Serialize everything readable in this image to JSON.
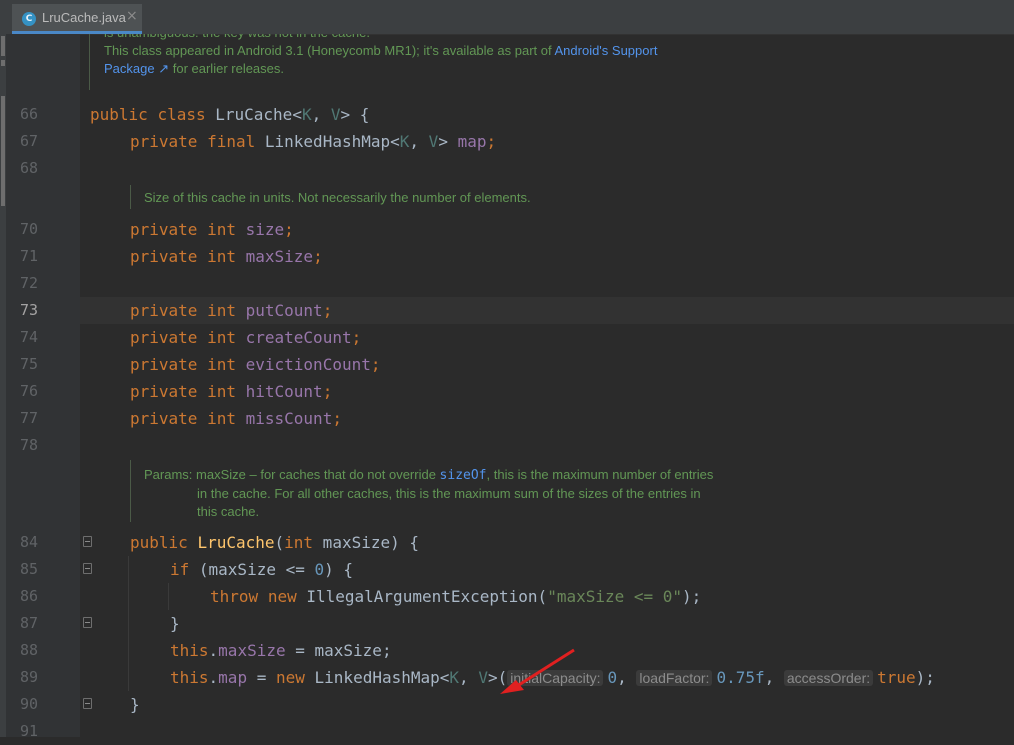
{
  "tab": {
    "icon_letter": "C",
    "title": "LruCache.java",
    "close_glyph": "×"
  },
  "doc_top": {
    "line1": "is unambiguous: the key was not in the cache.",
    "line2_prefix": "This class appeared in Android 3.1 (Honeycomb MR1); it's available as part of ",
    "line2_link": "Android's Support",
    "line3_link": "Package",
    "line3_arrow": "↗",
    "line3_suffix": " for earlier releases."
  },
  "doc_size": "Size of this cache in units. Not necessarily the number of elements.",
  "doc_params": {
    "label": "Params:",
    "text1_prefix": "maxSize – for caches that do not override ",
    "text1_code": "sizeOf",
    "text1_suffix": ", this is the maximum number of entries",
    "text2": "in the cache. For all other caches, this is the maximum sum of the sizes of the entries in",
    "text3": "this cache."
  },
  "line_numbers": {
    "l66": "66",
    "l67": "67",
    "l68": "68",
    "l70": "70",
    "l71": "71",
    "l72": "72",
    "l73": "73",
    "l74": "74",
    "l75": "75",
    "l76": "76",
    "l77": "77",
    "l78": "78",
    "l84": "84",
    "l85": "85",
    "l86": "86",
    "l87": "87",
    "l88": "88",
    "l89": "89",
    "l90": "90",
    "l91": "91"
  },
  "code": {
    "public": "public",
    "class": "class",
    "private": "private",
    "final": "final",
    "int": "int",
    "if": "if",
    "throw": "throw",
    "new": "new",
    "this": "this",
    "true": "true",
    "class_name": "LruCache",
    "type_params_open": "<",
    "K": "K",
    "comma": ", ",
    "V": "V",
    "type_params_close": ">",
    "open_brace": " {",
    "close_brace": "}",
    "linkedhashmap": "LinkedHashMap",
    "map": "map",
    "semicolon": ";",
    "size": "size",
    "maxSize": "maxSize",
    "putCount": "putCount",
    "createCount": "createCount",
    "evictionCount": "evictionCount",
    "hitCount": "hitCount",
    "missCount": "missCount",
    "ctor_params": "(int maxSize) {",
    "ctor_param_kw": "int",
    "ctor_param_name": " maxSize) {",
    "if_cond_a": " (maxSize <= ",
    "zero": "0",
    "if_cond_b": ") {",
    "exception": "IllegalArgumentException",
    "exc_open": "(",
    "exc_msg": "\"maxSize <= 0\"",
    "exc_close": ");",
    "dot": ".",
    "assign_max": " = maxSize;",
    "assign_eq": " = ",
    "lhm_open": ">(",
    "hint_capacity": "initialCapacity:",
    "hint_load": "loadFactor:",
    "hint_order": "accessOrder:",
    "load_value": "0.75f",
    "arg_sep": ", ",
    "call_end": ");",
    "lt": "<",
    "gt": ">"
  },
  "colors": {
    "keyword": "#cc7832",
    "field": "#9876aa",
    "number": "#6897bb",
    "string": "#6a8759",
    "method": "#ffc66d",
    "doc": "#629755",
    "annotation_arrow": "#e02020"
  }
}
